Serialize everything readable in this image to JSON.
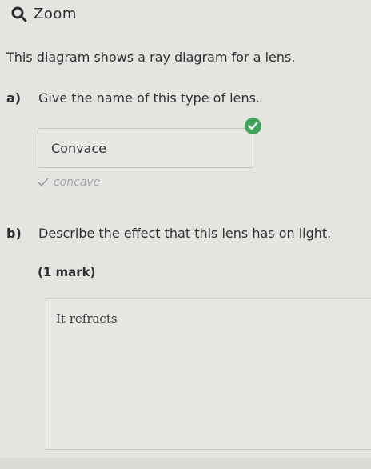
{
  "header": {
    "title": "Zoom",
    "icon": "zoom-search-icon"
  },
  "intro": "This diagram shows a ray diagram for a lens.",
  "question_a": {
    "letter": "a)",
    "text": "Give the name of this type of lens.",
    "answer": "Convace",
    "status": "correct",
    "correct_answer": "concave"
  },
  "question_b": {
    "letter": "b)",
    "text": "Describe the effect that this lens has on light.",
    "marks": "(1 mark)",
    "answer": "It refracts"
  },
  "colors": {
    "success": "#3da35a",
    "background": "#e6e4e0"
  }
}
